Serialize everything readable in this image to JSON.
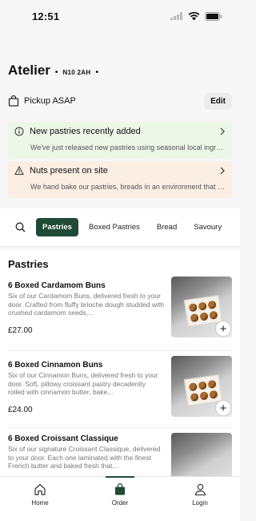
{
  "status_bar": {
    "time": "12:51"
  },
  "store": {
    "name": "Atelier",
    "separator_left": "•",
    "postcode": "N10 2AH",
    "separator_right": "•"
  },
  "pickup": {
    "label": "Pickup ASAP",
    "edit_label": "Edit"
  },
  "notices": [
    {
      "title": "New pastries recently added",
      "body": "We've just released new pastries using seasonal local ingredients",
      "color": "#ecf7e8"
    },
    {
      "title": "Nuts present on site",
      "body": "We hand bake our pastries, breads in an environment that contains nuts",
      "color": "#fbeee3"
    }
  ],
  "tabs": [
    {
      "label": "Pastries",
      "active": true
    },
    {
      "label": "Boxed Pastries",
      "active": false
    },
    {
      "label": "Bread",
      "active": false
    },
    {
      "label": "Savoury",
      "active": false
    }
  ],
  "section_title": "Pastries",
  "products": [
    {
      "name": "6 Boxed Cardamom Buns",
      "description": "Six of our Cardamom Buns, delivered fresh to your door. Crafted from fluffy brioche dough studded with crushed cardamom seeds,...",
      "price": "£27.00"
    },
    {
      "name": "6 Boxed Cinnamon Buns",
      "description": "Six of our Cinnamon Buns, delivered fresh to your door. Soft, pillowy croissant pastry decadently rolled with cinnamon butter, bake...",
      "price": "£24.00"
    },
    {
      "name": "6 Boxed Croissant Classique",
      "description": "Six of our signature Croissant Classique, delivered to your door. Each one laminated with the finest French butter and baked fresh that...",
      "price": ""
    }
  ],
  "bottom_nav": [
    {
      "label": "Home",
      "icon": "home-icon",
      "active": false
    },
    {
      "label": "Order",
      "icon": "bag-icon",
      "active": true
    },
    {
      "label": "Login",
      "icon": "user-icon",
      "active": false
    }
  ],
  "colors": {
    "accent": "#1f4a35",
    "notice_green": "#ecf7e8",
    "notice_orange": "#fbeee3"
  }
}
